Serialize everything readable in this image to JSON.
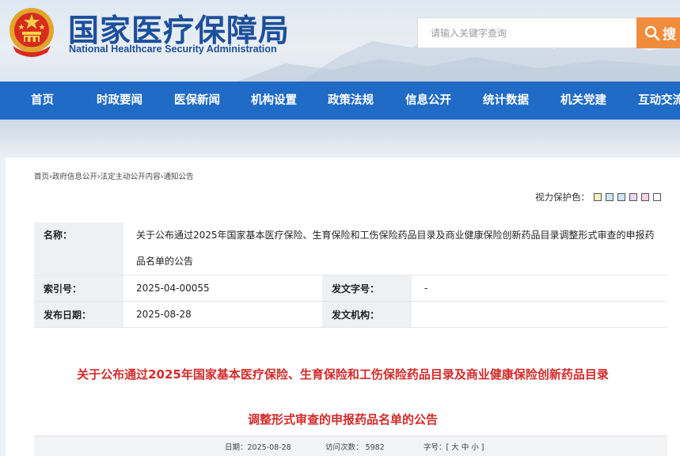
{
  "header": {
    "logo_cn": "国家医疗保障局",
    "logo_en": "National Healthcare Security Administration",
    "search_placeholder": "请输入关键字查询",
    "search_button": "搜"
  },
  "nav": {
    "items": [
      "首页",
      "时政要闻",
      "医保新闻",
      "机构设置",
      "政策法规",
      "信息公开",
      "统计数据",
      "机关党建",
      "互动交流"
    ]
  },
  "breadcrumb": [
    "首页",
    "政府信息公开",
    "法定主动公开内容",
    "通知公告"
  ],
  "breadcrumb_sep": "›",
  "vision": {
    "label": "视力保护色：",
    "colors": [
      "#f7f0c2",
      "#c9e7f3",
      "#cfe2f7",
      "#e8d6f0",
      "#f4d4e4",
      "#ffffff"
    ]
  },
  "meta": {
    "name_label": "名称：",
    "name_value": "关于公布通过2025年国家基本医疗保险、生育保险和工伤保险药品目录及商业健康保险创新药品目录调整形式审查的申报药品名单的公告",
    "index_label": "索引号：",
    "index_value": "2025-04-00055",
    "docno_label": "发文字号：",
    "docno_value": "-",
    "date_label": "发布日期：",
    "date_value": "2025-08-28",
    "org_label": "发文机构：",
    "org_value": ""
  },
  "article": {
    "title_line1": "关于公布通过2025年国家基本医疗保险、生育保险和工伤保险药品目录及商业健康保险创新药品目录",
    "title_line2": "调整形式审查的申报药品名单的公告",
    "info_date": "日期：2025-08-28",
    "info_views": "访问次数： 5982",
    "info_font": "字号：[ 大 中 小 ]"
  },
  "colors": {
    "brand_blue": "#1d4f9b",
    "nav_blue": "#1f6bc6",
    "search_orange": "#f08c3c",
    "title_red": "#d32a2a"
  },
  "icons": {
    "emblem": "national-emblem-icon",
    "search": "magnifier-icon"
  }
}
